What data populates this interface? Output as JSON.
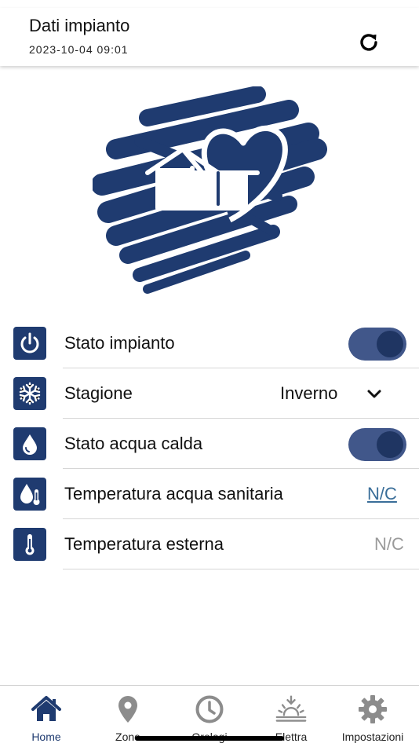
{
  "header": {
    "title": "Dati impianto",
    "date": "2023-10-04 09:01"
  },
  "rows": [
    {
      "label": "Stato impianto",
      "icon": "power-icon",
      "control": "toggle",
      "value": "on"
    },
    {
      "label": "Stagione",
      "icon": "snowflake-icon",
      "control": "select",
      "value": "Inverno"
    },
    {
      "label": "Stato acqua calda",
      "icon": "water-drop-icon",
      "control": "toggle",
      "value": "on"
    },
    {
      "label": "Temperatura acqua sanitaria",
      "icon": "drop-thermometer-icon",
      "control": "link",
      "value": "N/C"
    },
    {
      "label": "Temperatura esterna",
      "icon": "thermometer-icon",
      "control": "text",
      "value": "N/C"
    }
  ],
  "tabs": [
    {
      "label": "Home",
      "icon": "home-icon",
      "active": true
    },
    {
      "label": "Zone",
      "icon": "location-pin-icon",
      "active": false
    },
    {
      "label": "Orologi",
      "icon": "clock-icon",
      "active": false
    },
    {
      "label": "Elettra",
      "icon": "sunrise-icon",
      "active": false
    },
    {
      "label": "Impostazioni",
      "icon": "gear-icon",
      "active": false
    }
  ],
  "colors": {
    "brand": "#1f3b70",
    "toggle_track": "#41578a",
    "toggle_knob": "#1f3562",
    "link": "#3a6e99",
    "muted": "#9a9a9a"
  }
}
